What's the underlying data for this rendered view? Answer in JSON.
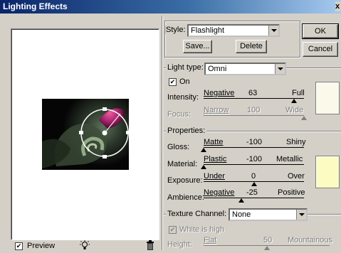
{
  "window": {
    "title": "Lighting Effects",
    "close_glyph": "x"
  },
  "style_row": {
    "label": "Style:",
    "value": "Flashlight",
    "ok": "OK",
    "cancel": "Cancel",
    "save": "Save...",
    "delete": "Delete"
  },
  "light": {
    "type_label": "Light type:",
    "type_value": "Omni",
    "on_label": "On",
    "on_checked": true,
    "intensity": {
      "label": "Intensity:",
      "min": "Negative",
      "value": "63",
      "max": "Full",
      "level": 0.9
    },
    "focus": {
      "label": "Focus:",
      "min": "Narrow",
      "value": "100",
      "max": "Wide",
      "level": 1.0
    },
    "color": "#fbf9e9"
  },
  "properties": {
    "label": "Properties:",
    "gloss": {
      "label": "Gloss:",
      "min": "Matte",
      "value": "-100",
      "max": "Shiny",
      "level": 0.0
    },
    "material": {
      "label": "Material:",
      "min": "Plastic",
      "value": "-100",
      "max": "Metallic",
      "level": 0.0
    },
    "exposure": {
      "label": "Exposure:",
      "min": "Under",
      "value": "0",
      "max": "Over",
      "level": 0.5
    },
    "ambience": {
      "label": "Ambience:",
      "min": "Negative",
      "value": "-25",
      "max": "Positive",
      "level": 0.375
    },
    "color": "#fcfbc2"
  },
  "texture": {
    "channel_label": "Texture Channel:",
    "channel_value": "None",
    "white_is_high": "White is high",
    "height": {
      "label": "Height:",
      "min": "Flat",
      "value": "50",
      "max": "Mountainous",
      "level": 0.5
    }
  },
  "preview": {
    "label": "Preview",
    "checked": true
  },
  "icons": [
    "lightbulb-icon",
    "trash-icon",
    "checkbox-check-icon",
    "dropdown-arrow-icon"
  ]
}
